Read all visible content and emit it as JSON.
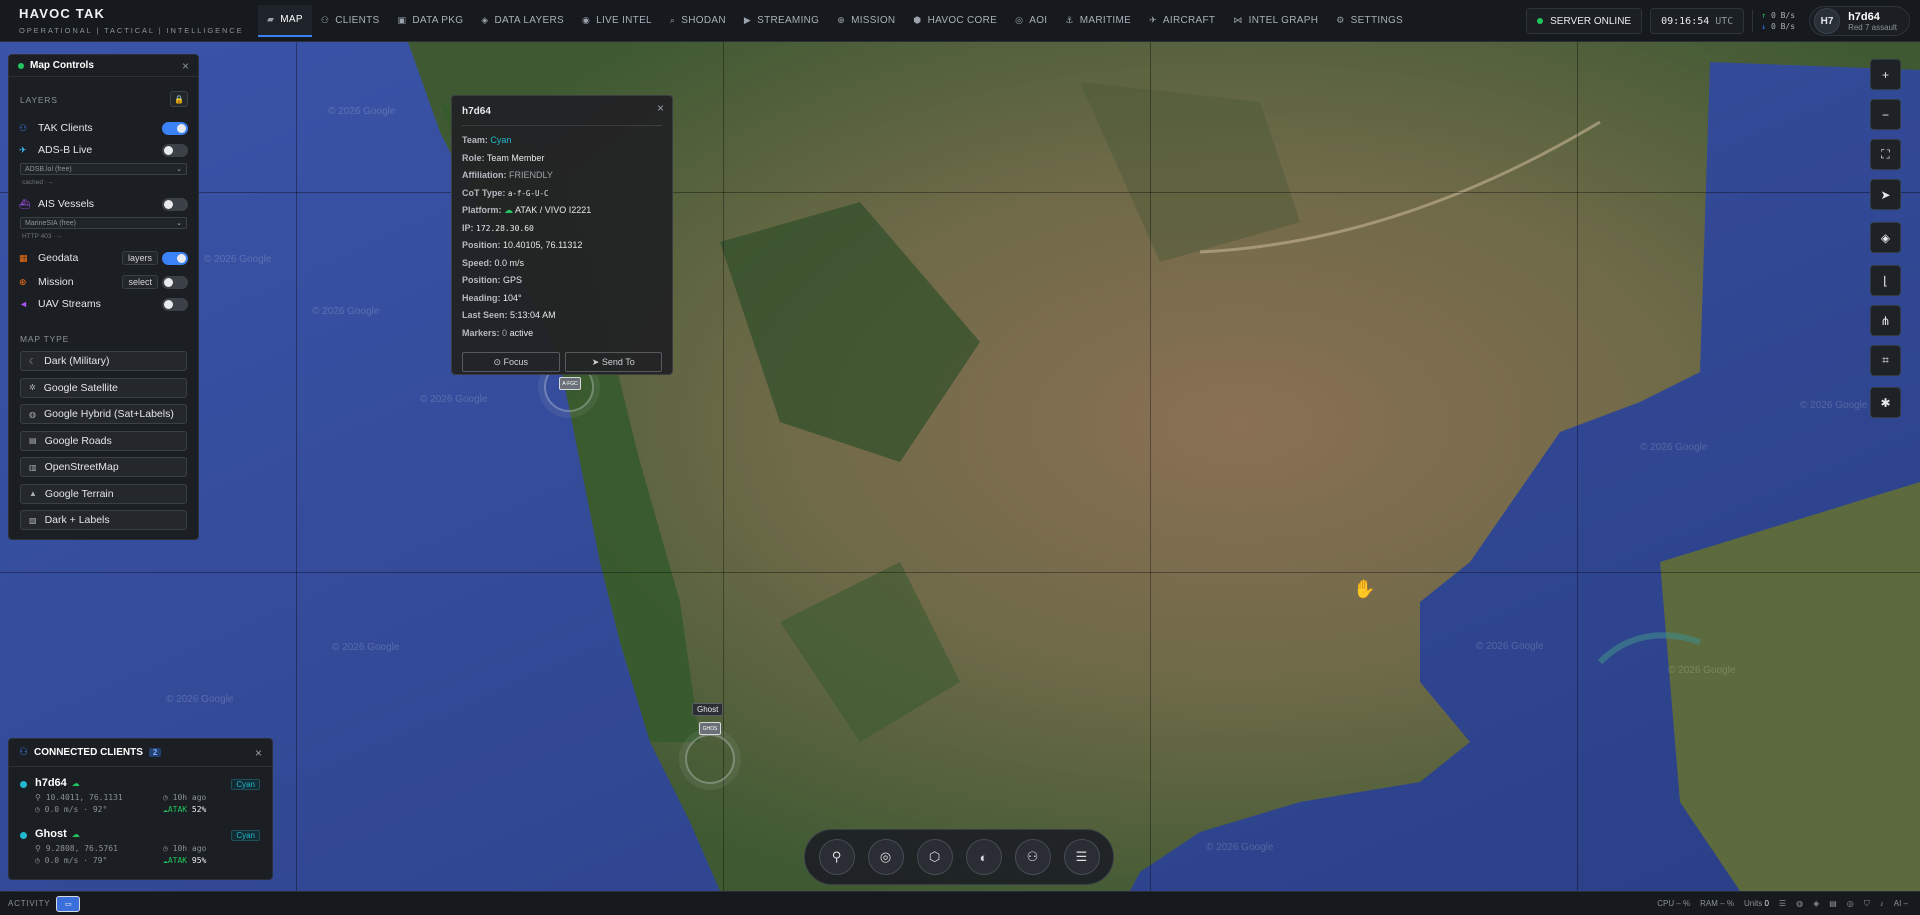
{
  "brand": {
    "title": "HAVOC TAK",
    "subtitle": "OPERATIONAL  |  TACTICAL  |  INTELLIGENCE"
  },
  "nav": [
    {
      "label": "MAP",
      "icon": "map-icon",
      "glyph": "▰",
      "active": true
    },
    {
      "label": "CLIENTS",
      "icon": "users-icon",
      "glyph": "⚇"
    },
    {
      "label": "DATA PKG",
      "icon": "package-icon",
      "glyph": "▣"
    },
    {
      "label": "DATA LAYERS",
      "icon": "layers-icon",
      "glyph": "◈"
    },
    {
      "label": "LIVE INTEL",
      "icon": "broadcast-icon",
      "glyph": "◉"
    },
    {
      "label": "SHODAN",
      "icon": "search-icon",
      "glyph": "⌕"
    },
    {
      "label": "STREAMING",
      "icon": "video-icon",
      "glyph": "▶"
    },
    {
      "label": "MISSION",
      "icon": "crosshair-icon",
      "glyph": "⊕"
    },
    {
      "label": "HAVOC CORE",
      "icon": "core-icon",
      "glyph": "⬢"
    },
    {
      "label": "AOI",
      "icon": "target-icon",
      "glyph": "◎"
    },
    {
      "label": "MARITIME",
      "icon": "ship-icon",
      "glyph": "⚓"
    },
    {
      "label": "AIRCRAFT",
      "icon": "plane-icon",
      "glyph": "✈"
    },
    {
      "label": "INTEL GRAPH",
      "icon": "graph-icon",
      "glyph": "⋈"
    },
    {
      "label": "SETTINGS",
      "icon": "gear-icon",
      "glyph": "⚙"
    }
  ],
  "status": {
    "server": "SERVER ONLINE",
    "clock": "09:16:54",
    "tz": "UTC",
    "net_up": "0 B/s",
    "net_down": "0 B/s"
  },
  "user": {
    "initials": "H7",
    "name": "h7d64",
    "role": "Red 7 assault"
  },
  "map_controls": {
    "title": "Map Controls",
    "layers_title": "LAYERS",
    "layers": [
      {
        "label": "TAK Clients",
        "icon": "users-icon",
        "color": "#3b82f6",
        "on": true
      },
      {
        "label": "ADS-B Live",
        "icon": "plane-icon",
        "color": "#38bdf8",
        "on": false,
        "select": "ADSB.lol (free)",
        "status": "cached · --"
      },
      {
        "label": "AIS Vessels",
        "icon": "ship-icon",
        "color": "#a855f7",
        "on": false,
        "select": "MarineSIA (free)",
        "status": "HTTP 403 · --"
      },
      {
        "label": "Geodata",
        "icon": "geodata-icon",
        "color": "#f97316",
        "on": true,
        "button": "layers"
      },
      {
        "label": "Mission",
        "icon": "mission-icon",
        "color": "#f97316",
        "on": false,
        "button": "select"
      },
      {
        "label": "UAV Streams",
        "icon": "uav-icon",
        "color": "#a855f7",
        "on": false
      }
    ],
    "map_type_title": "MAP TYPE",
    "map_types": [
      {
        "label": "Dark (Military)",
        "icon": "moon-icon",
        "glyph": "☾"
      },
      {
        "label": "Google Satellite",
        "icon": "satellite-icon",
        "glyph": "✲"
      },
      {
        "label": "Google Hybrid (Sat+Labels)",
        "icon": "globe-icon",
        "glyph": "◍"
      },
      {
        "label": "Google Roads",
        "icon": "road-icon",
        "glyph": "▤"
      },
      {
        "label": "OpenStreetMap",
        "icon": "map-icon",
        "glyph": "▥"
      },
      {
        "label": "Google Terrain",
        "icon": "mountain-icon",
        "glyph": "▲"
      },
      {
        "label": "Dark + Labels",
        "icon": "tag-icon",
        "glyph": "▧"
      }
    ]
  },
  "popup": {
    "title": "h7d64",
    "team": "Cyan",
    "role": "Team Member",
    "affiliation": "FRIENDLY",
    "cot_type": "a-f-G-U-C",
    "platform": "ATAK / VIVO I2221",
    "ip": "172.28.30.60",
    "position": "10.40105, 76.11312",
    "speed": "0.0 m/s",
    "position_src": "GPS",
    "heading": "104°",
    "last_seen": "5:13:04 AM",
    "markers_count": "0",
    "markers_suffix": "active",
    "labels": {
      "team": "Team:",
      "role": "Role:",
      "affiliation": "Affiliation:",
      "cot": "CoT Type:",
      "platform": "Platform:",
      "ip": "IP:",
      "position": "Position:",
      "speed": "Speed:",
      "position_src": "Position:",
      "heading": "Heading:",
      "last_seen": "Last Seen:",
      "markers": "Markers:"
    },
    "focus": "Focus",
    "send": "Send To"
  },
  "map_markers": {
    "ghost_label": "Ghost",
    "ghost_icon": "GHOS",
    "h7_icon": "A-FGC"
  },
  "watermark": "© 2026 Google",
  "connected": {
    "title": "CONNECTED CLIENTS",
    "count": "2",
    "clients": [
      {
        "name": "h7d64",
        "team": "Cyan",
        "pos": "10.4011, 76.1131",
        "motion": "0.0 m/s · 92°",
        "ago": "10h ago",
        "atk": "ATAK",
        "battery": "52%"
      },
      {
        "name": "Ghost",
        "team": "Cyan",
        "pos": "9.2808, 76.5761",
        "motion": "0.0 m/s · 79°",
        "ago": "10h ago",
        "atk": "ATAK",
        "battery": "95%"
      }
    ]
  },
  "statusbar": {
    "activity": "ACTIVITY",
    "cpu": "CPU",
    "cpu_val": "–",
    "pct": "%",
    "ram": "RAM",
    "ram_val": "–",
    "units": "Units",
    "units_val": "0",
    "ai": "AI –"
  }
}
